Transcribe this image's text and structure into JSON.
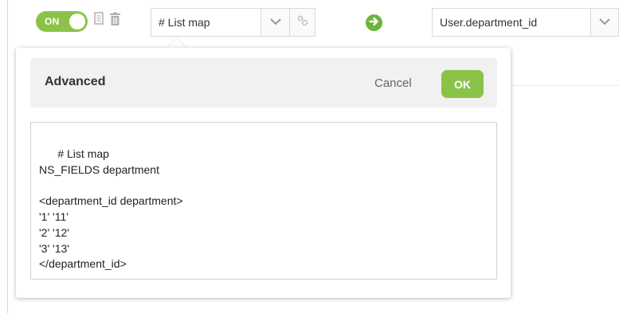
{
  "toolbar": {
    "toggle_label": "ON",
    "list_select_value": "# List map",
    "field_select_value": "User.department_id"
  },
  "panel": {
    "title": "Advanced",
    "cancel_label": "Cancel",
    "ok_label": "OK",
    "editor_text": "# List map\nNS_FIELDS department\n\n<department_id department>\n'1' '11'\n'2' '12'\n'3' '13'\n</department_id>"
  },
  "icons": [
    "copy-icon",
    "trash-icon",
    "chevron-down-icon",
    "gears-icon",
    "arrow-right-circle-icon",
    "resize-handle-icon"
  ],
  "colors": {
    "accent_green": "#8bc34a",
    "arrow_green": "#6db33f",
    "header_bg": "#f1f1f1",
    "border_gray": "#d9d9d9"
  }
}
